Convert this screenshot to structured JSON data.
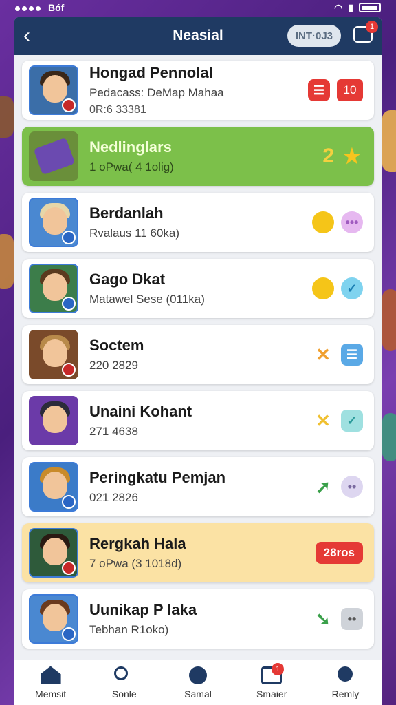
{
  "status_bar": {
    "carrier": "Bóf"
  },
  "header": {
    "title": "Neasial",
    "pill_label": "INT·0J3",
    "notification_count": "1"
  },
  "list": [
    {
      "name": "Hongad Pennolal",
      "sub": "Pedacass: DeMap Mahaa",
      "sub2": "0R:6 33381",
      "right_count": "10",
      "variant": "white"
    },
    {
      "name": "Nedlinglars",
      "sub": "1 oPwa( 4 1olig)",
      "right_number": "2",
      "variant": "green"
    },
    {
      "name": "Berdanlah",
      "sub": "Rvalaus 11 60ka)",
      "variant": "white"
    },
    {
      "name": "Gago Dkat",
      "sub": "Matawel Sese (011ka)",
      "variant": "white"
    },
    {
      "name": "Soctem",
      "sub": "220 2829",
      "variant": "white"
    },
    {
      "name": "Unaini Kohant",
      "sub": "271 4638",
      "variant": "white"
    },
    {
      "name": "Peringkatu Pemjan",
      "sub": "021 2826",
      "variant": "white"
    },
    {
      "name": "Rergkah Hala",
      "sub": "7 oPwa (3 1018d)",
      "right_pill": "28ros",
      "variant": "yellow"
    },
    {
      "name": "Uunikap P laka",
      "sub": "Tebhan R1oko)",
      "variant": "white"
    }
  ],
  "bottom_nav": [
    {
      "label": "Memsit"
    },
    {
      "label": "Sonle"
    },
    {
      "label": "Samal"
    },
    {
      "label": "Smaier",
      "badge": "1"
    },
    {
      "label": "Remly"
    }
  ],
  "colors": {
    "header": "#1f3a63",
    "accent_red": "#e53935",
    "green_card": "#7cc04a",
    "yellow_card": "#fbe2a4"
  }
}
